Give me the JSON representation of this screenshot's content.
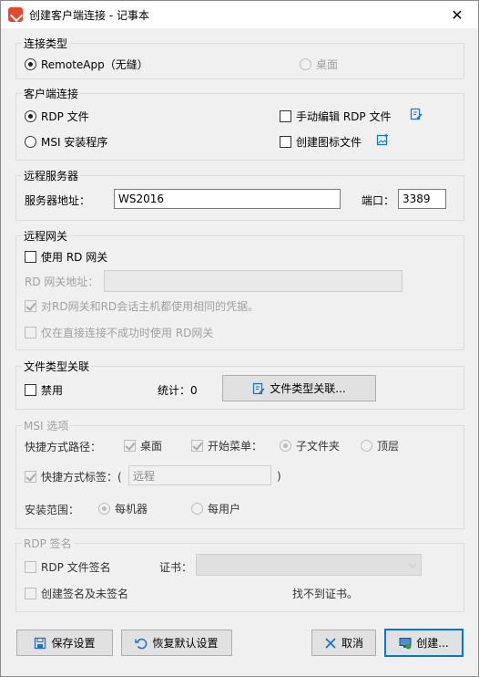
{
  "window": {
    "title": "创建客户端连接 - 记事本",
    "close": "✕"
  },
  "connection_type": {
    "legend": "连接类型",
    "remoteapp": "RemoteApp（无缝）",
    "desktop": "桌面"
  },
  "client_connection": {
    "legend": "客户端连接",
    "rdp_file": "RDP 文件",
    "msi": "MSI 安装程序",
    "manual_edit": "手动编辑 RDP 文件",
    "create_icon": "创建图标文件"
  },
  "remote_server": {
    "legend": "远程服务器",
    "address_label": "服务器地址：",
    "address_value": "WS2016",
    "port_label": "端口：",
    "port_value": "3389"
  },
  "gateway": {
    "legend": "远程网关",
    "use_rd_gateway": "使用 RD 网关",
    "address_label": "RD 网关地址：",
    "same_credentials": "对RD网关和RD会话主机都使用相同的凭据。",
    "only_if_fail": "仅在直接连接不成功时使用 RD网关"
  },
  "file_assoc": {
    "legend": "文件类型关联",
    "disable": "禁用",
    "stats": "统计：0",
    "button": "文件类型关联..."
  },
  "msi_options": {
    "legend": "MSI 选项",
    "shortcut_path": "快捷方式路径：",
    "desktop": "桌面",
    "start_menu": "开始菜单：",
    "subfolder": "子文件夹",
    "top_level": "顶层",
    "shortcut_tag": "快捷方式标签：(",
    "shortcut_tag_value": "远程",
    "shortcut_tag_close": ")",
    "install_scope": "安装范围：",
    "per_machine": "每机器",
    "per_user": "每用户"
  },
  "rdp_signing": {
    "legend": "RDP 签名",
    "sign_file": "RDP 文件签名",
    "cert_label": "证书：",
    "create_both": "创建签名及未签名",
    "no_cert": "找不到证书。"
  },
  "buttons": {
    "save": "保存设置",
    "restore": "恢复默认设置",
    "cancel": "取消",
    "create": "创建..."
  }
}
